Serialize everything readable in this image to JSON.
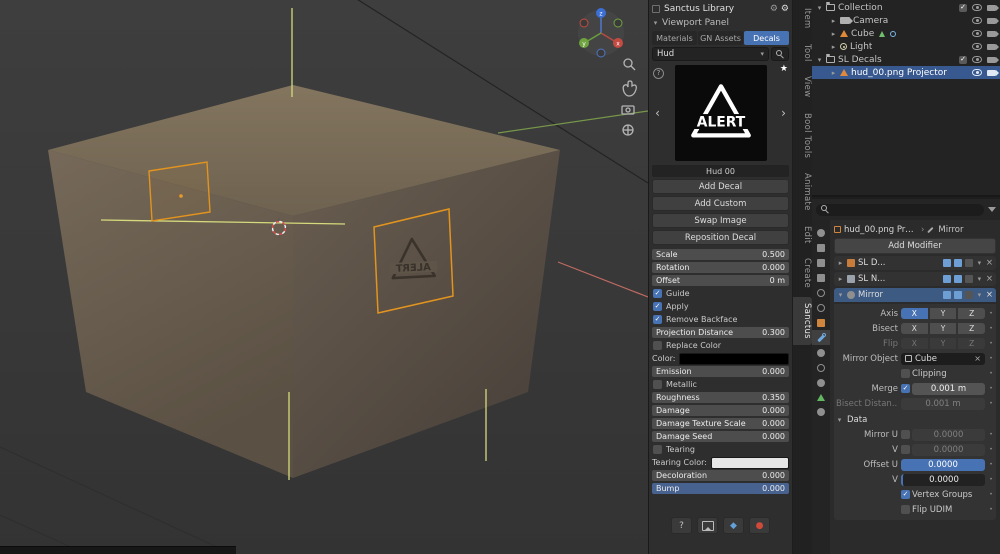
{
  "icons": {
    "check": "✓",
    "collapse": "▾",
    "expand": "▸",
    "dropdown": "▾",
    "close": "×",
    "star": "★",
    "gear": "⚙",
    "chevron_left": "‹",
    "chevron_right": "›",
    "crumb_sep": "›",
    "help": "?",
    "diamond": "◆",
    "record": "●",
    "dot": "•"
  },
  "viewport": {
    "decal_text": "ALERT",
    "gizmo": {
      "x": "x",
      "y": "y",
      "z": "z"
    }
  },
  "npanel": {
    "title": "Sanctus Library",
    "viewport_panel": "Viewport Panel",
    "tabs": [
      "Materials",
      "GN Assets",
      "Decals"
    ],
    "active_tab": "Decals",
    "category": "Hud",
    "preview": {
      "name": "Hud 00",
      "logo_text": "ALERT"
    },
    "buttons": [
      "Add Decal",
      "Add Custom",
      "Swap Image",
      "Reposition Decal"
    ],
    "params": [
      {
        "type": "field",
        "label": "Scale",
        "value": "0.500"
      },
      {
        "type": "field",
        "label": "Rotation",
        "value": "0.000"
      },
      {
        "type": "field",
        "label": "Offset",
        "value": "0 m"
      },
      {
        "type": "check",
        "label": "Guide",
        "checked": true
      },
      {
        "type": "check",
        "label": "Apply",
        "checked": true
      },
      {
        "type": "check",
        "label": "Remove Backface",
        "checked": true
      },
      {
        "type": "field",
        "label": "Projection Distance",
        "value": "0.300"
      },
      {
        "type": "check",
        "label": "Replace Color",
        "checked": false
      },
      {
        "type": "color",
        "label": "Color:",
        "swatch": "#000000"
      },
      {
        "type": "field",
        "label": "Emission",
        "value": "0.000"
      },
      {
        "type": "check",
        "label": "Metallic",
        "checked": false
      },
      {
        "type": "field",
        "label": "Roughness",
        "value": "0.350"
      },
      {
        "type": "field",
        "label": "Damage",
        "value": "0.000"
      },
      {
        "type": "field",
        "label": "Damage Texture Scale",
        "value": "0.000"
      },
      {
        "type": "field",
        "label": "Damage Seed",
        "value": "0.000"
      },
      {
        "type": "check",
        "label": "Tearing",
        "checked": false
      },
      {
        "type": "color",
        "label": "Tearing Color:",
        "swatch": "#e6e6e6"
      },
      {
        "type": "field",
        "label": "Decoloration",
        "value": "0.000"
      },
      {
        "type": "field",
        "label": "Bump",
        "value": "0.000"
      }
    ]
  },
  "tabstrip": {
    "items": [
      "Item",
      "Tool",
      "View",
      "Bool Tools",
      "Animate",
      "Edit",
      "Create",
      "Sanctus"
    ],
    "active": "Sanctus"
  },
  "outliner": {
    "rows": [
      {
        "label": "Collection"
      },
      {
        "label": "Camera"
      },
      {
        "label": "Cube"
      },
      {
        "label": "Light"
      },
      {
        "label": "SL Decals"
      },
      {
        "label": "hud_00.png Projector"
      }
    ]
  },
  "properties": {
    "breadcrumb": {
      "object": "hud_00.png Proje...",
      "modifier": "Mirror"
    },
    "add_modifier": "Add Modifier",
    "stack": [
      {
        "name": "SL D..."
      },
      {
        "name": "SL N..."
      },
      {
        "name": "Mirror"
      }
    ],
    "mirror": {
      "axis": "Axis",
      "bisect": "Bisect",
      "flip": "Flip",
      "x": "X",
      "y": "Y",
      "z": "Z",
      "mirror_object": "Mirror Object",
      "mirror_object_value": "Cube",
      "clipping": "Clipping",
      "merge": "Merge",
      "merge_value": "0.001 m",
      "bisect_distance": "Bisect Distan...",
      "bisect_distance_value": "0.001 m",
      "data": "Data",
      "mirror_u": "Mirror U",
      "mirror_u_value": "0.0000",
      "v": "V",
      "mirror_v_value": "0.0000",
      "offset_u": "Offset U",
      "offset_u_value": "0.0000",
      "offset_v": "V",
      "offset_v_value": "0.0000",
      "vertex_groups": "Vertex Groups",
      "flip_udim": "Flip UDIM"
    }
  },
  "colors": {
    "accent": "#4772b3",
    "selection": "#37598f",
    "decal_outline": "#e2941f",
    "guide_yellow": "#d6da7c"
  }
}
